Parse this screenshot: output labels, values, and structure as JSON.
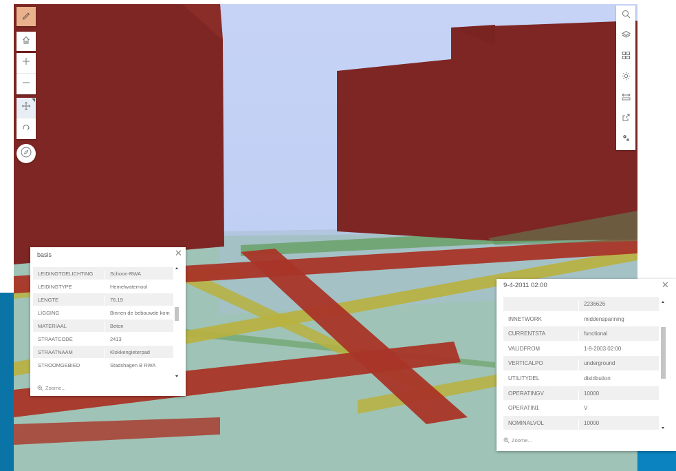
{
  "left_toolbar": {
    "buttons": [
      {
        "name": "pencil-icon",
        "glyph": "✎",
        "state": "active"
      },
      {
        "name": "home-icon",
        "glyph": "⌂"
      },
      {
        "name": "zoom-in-icon",
        "glyph": "+"
      },
      {
        "name": "zoom-out-icon",
        "glyph": "−"
      },
      {
        "name": "pan-icon",
        "glyph": "✥",
        "state": "selected"
      },
      {
        "name": "rotate-icon",
        "glyph": "↻"
      }
    ],
    "compass_icon": "compass-icon"
  },
  "right_toolbar": {
    "buttons": [
      {
        "name": "search-icon",
        "glyph": "⌕"
      },
      {
        "name": "layers-icon",
        "glyph": "◈"
      },
      {
        "name": "basemap-gallery-icon",
        "glyph": "▦"
      },
      {
        "name": "daylight-icon",
        "glyph": "☼"
      },
      {
        "name": "measure-icon",
        "glyph": "⇿"
      },
      {
        "name": "share-icon",
        "glyph": "⧉"
      },
      {
        "name": "settings-icon",
        "glyph": "⚙"
      }
    ]
  },
  "popup_basis": {
    "title": "basis",
    "close_glyph": "✕",
    "zoom_label": "Zoome...",
    "scroll": {
      "position": 0.4
    },
    "rows": [
      {
        "key": "LEIDINGTOELICHTING",
        "value": "Schoon-RWA"
      },
      {
        "key": "LEIDINGTYPE",
        "value": "Hemelwaterriool"
      },
      {
        "key": "LENGTE",
        "value": "76.19"
      },
      {
        "key": "LIGGING",
        "value": "Binnen de bebouwde kom"
      },
      {
        "key": "MATERIAAL",
        "value": "Beton"
      },
      {
        "key": "STRAATCODE",
        "value": "2413"
      },
      {
        "key": "STRAATNAAM",
        "value": "Klokkengieterpad"
      },
      {
        "key": "STROOMGEBIED",
        "value": "Stadshagen B RWA"
      }
    ]
  },
  "popup_network": {
    "title": "9-4-2011 02:00",
    "close_glyph": "✕",
    "zoom_label": "Zoome...",
    "scroll": {
      "position": 0.3
    },
    "rows": [
      {
        "key": "",
        "value": "2236626"
      },
      {
        "key": "INNETWORK",
        "value": "middenspanning"
      },
      {
        "key": "CURRENTSTA",
        "value": "functional"
      },
      {
        "key": "VALIDFROM",
        "value": "1-9-2003 02:00"
      },
      {
        "key": "VERTICALPO",
        "value": "underground"
      },
      {
        "key": "UTILITYDEL",
        "value": "distribution"
      },
      {
        "key": "OPERATINGV",
        "value": "10000"
      },
      {
        "key": "OPERATIN1",
        "value": "V"
      },
      {
        "key": "NOMINALVOL",
        "value": "10000"
      }
    ]
  },
  "colors": {
    "sky": "#c3d2f5",
    "building": "#7e2623",
    "ground": "#9fc3b6",
    "pipe_red": "#a93528",
    "pipe_yellow": "#b9b13e",
    "pipe_green": "#5e9a55",
    "accent_blue": "#0b74a6",
    "active_tool": "#e9b28c"
  }
}
